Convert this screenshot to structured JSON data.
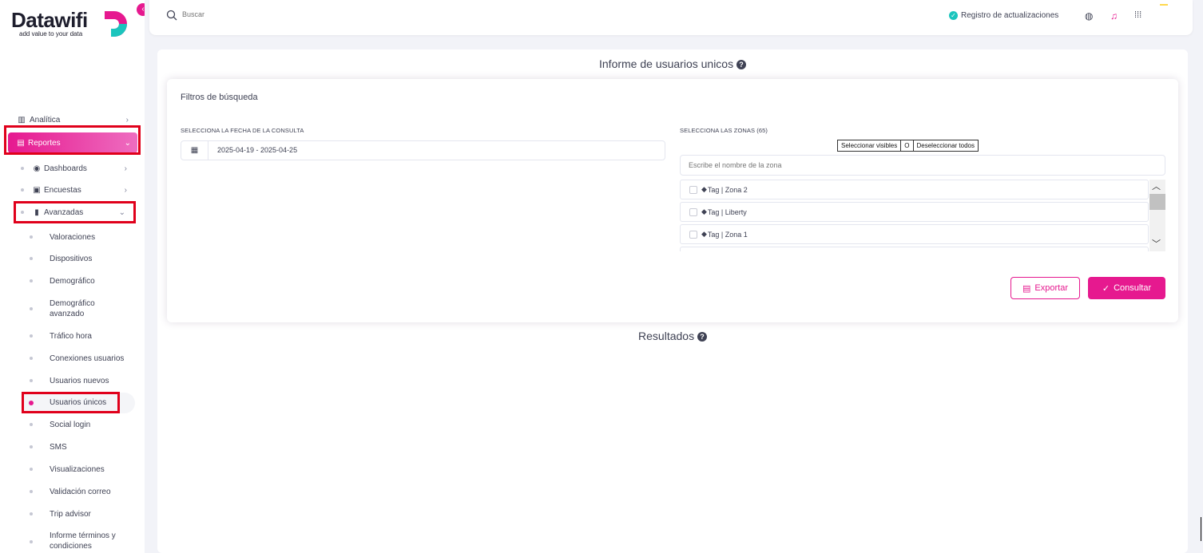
{
  "brand": {
    "name": "Datawifi",
    "reg": "®",
    "tagline": "add value to your data",
    "accent": "#e6198f"
  },
  "topbar": {
    "search_placeholder": "Buscar",
    "registro_label": "Registro de actualizaciones",
    "icons": [
      "globe-icon",
      "bell-icon",
      "apps-grid-icon"
    ]
  },
  "sidebar": {
    "analitica": "Analítica",
    "reportes": "Reportes",
    "dashboards": "Dashboards",
    "encuestas": "Encuestas",
    "avanzadas": "Avanzadas",
    "subitems": [
      "Valoraciones",
      "Dispositivos",
      "Demográfico",
      "Demográfico avanzado",
      "Tráfico hora",
      "Conexiones usuarios",
      "Usuarios nuevos",
      "Usuarios únicos",
      "Social login",
      "SMS",
      "Visualizaciones",
      "Validación correo",
      "Trip advisor",
      "Informe términos y condiciones"
    ],
    "active_item": "Usuarios únicos"
  },
  "main": {
    "title": "Informe de usuarios unicos",
    "filters_title": "Filtros de búsqueda",
    "date_label": "SELECCIONA LA FECHA DE LA CONSULTA",
    "date_value": "2025-04-19 - 2025-04-25",
    "zones_label": "SELECCIONA LAS ZONAS (65)",
    "select_visible": "Seleccionar visibles",
    "separator": "O",
    "deselect_all": "Deseleccionar todos",
    "zone_placeholder": "Escribe el nombre de la zona",
    "zones": [
      "Tag | Zona 2",
      "Tag | Liberty",
      "Tag | Zona 1"
    ],
    "export_label": "Exportar",
    "consult_label": "Consultar",
    "results_title": "Resultados"
  }
}
